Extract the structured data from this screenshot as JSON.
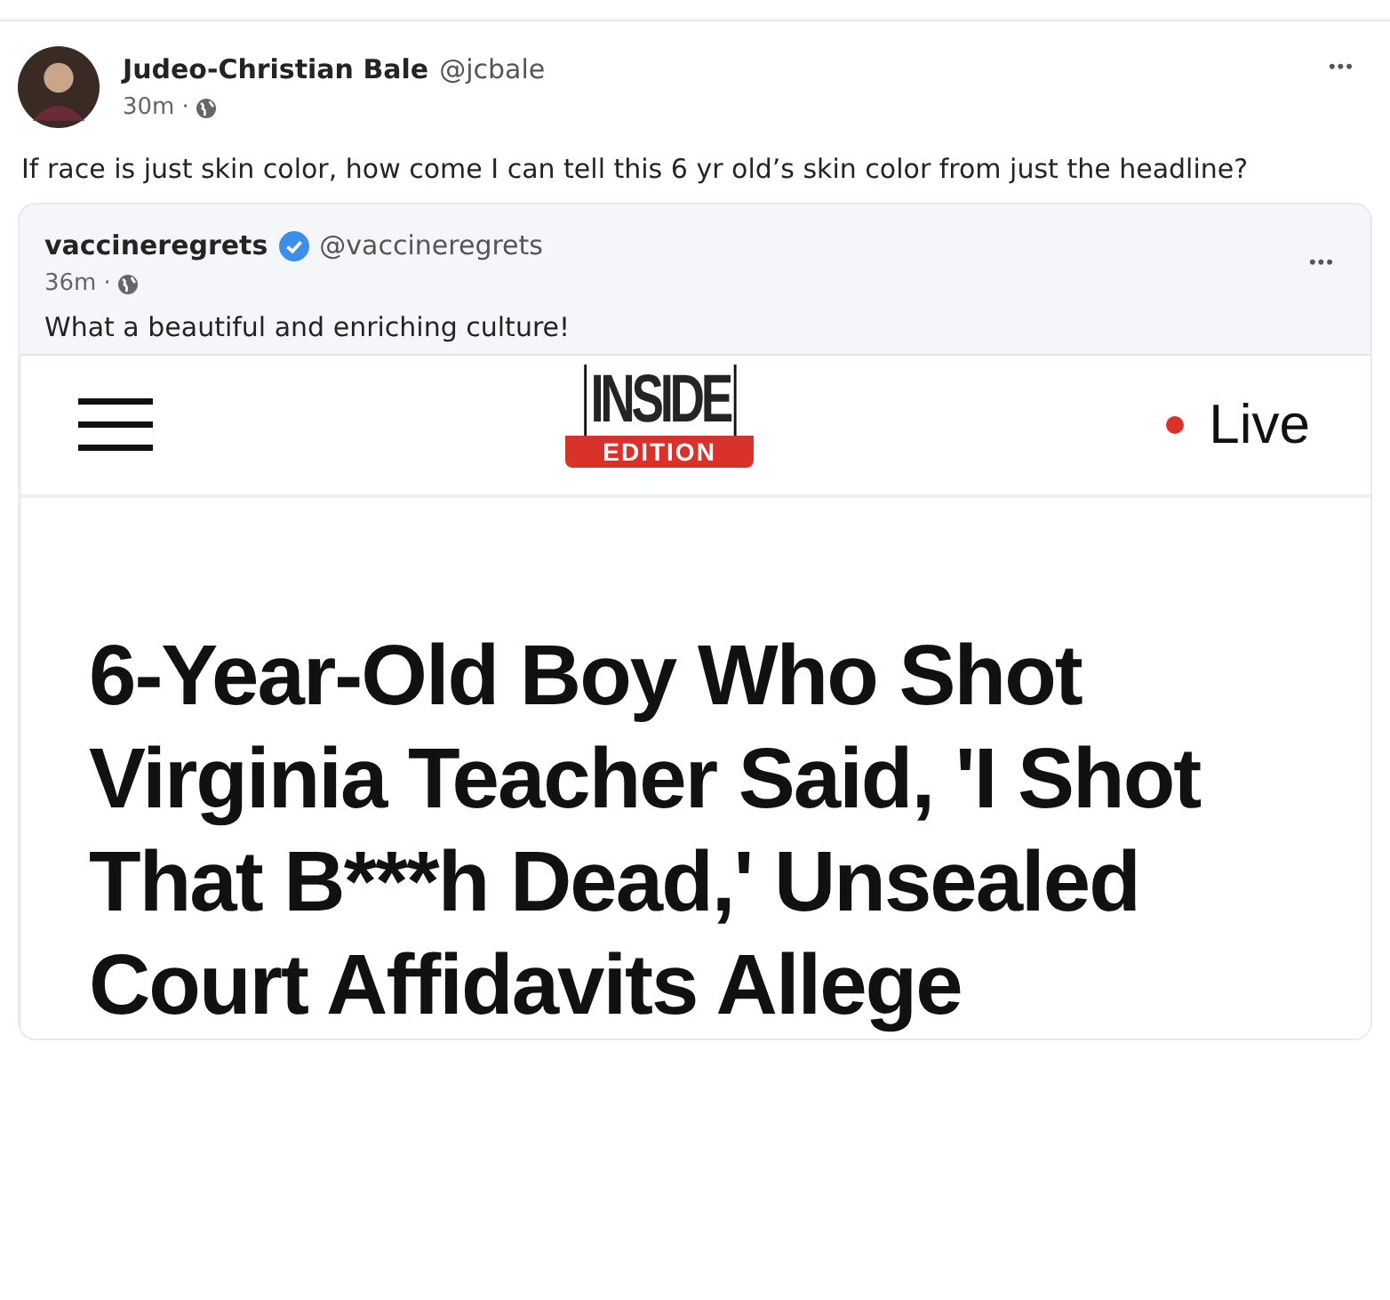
{
  "post": {
    "author": "Judeo-Christian Bale",
    "handle": "@jcbale",
    "time": "30m",
    "separator": "·",
    "menu": "•••",
    "text": "If race is just skin color, how come I can tell this 6 yr old’s skin color from just the headline?"
  },
  "quote": {
    "author": "vaccineregrets",
    "verified": true,
    "handle": "@vaccineregrets",
    "time": "36m",
    "separator": "·",
    "menu": "•••",
    "text": "What a beautiful and enriching culture!",
    "screenshot": {
      "logo_top": "INSIDE",
      "logo_bottom": "EDITION",
      "live": "Live",
      "headline": "6-Year-Old Boy Who Shot Virginia Teacher Said, 'I Shot That B***h Dead,' Unsealed Court Affidavits Allege"
    }
  }
}
